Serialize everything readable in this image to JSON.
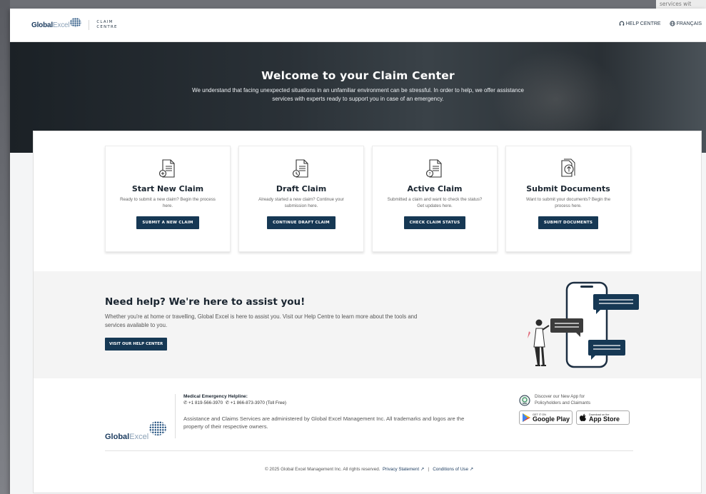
{
  "background_peek": "services wit",
  "header": {
    "logo_global": "Global",
    "logo_excel": "Excel",
    "claim": "CLAIM",
    "centre": "CENTRE",
    "help_centre": "HELP CENTRE",
    "language": "FRANÇAIS"
  },
  "hero": {
    "title": "Welcome to your Claim Center",
    "text": "We understand that facing unexpected situations in an unfamiliar environment can be stressful. In order to help, we offer assistance services with experts ready to support you in case of an emergency."
  },
  "cards": [
    {
      "icon": "new-claim-icon",
      "title": "Start New Claim",
      "text": "Ready to submit a new claim? Begin the process here.",
      "button": "SUBMIT A NEW CLAIM"
    },
    {
      "icon": "draft-claim-icon",
      "title": "Draft Claim",
      "text": "Already started a new claim? Continue your submission here.",
      "button": "CONTINUE DRAFT CLAIM"
    },
    {
      "icon": "active-claim-icon",
      "title": "Active Claim",
      "text": "Submitted a claim and want to check the status? Get updates here.",
      "button": "CHECK CLAIM STATUS"
    },
    {
      "icon": "upload-document-icon",
      "title": "Submit Documents",
      "text": "Want to submit your documents? Begin the process here.",
      "button": "SUBMIT DOCUMENTS"
    }
  ],
  "help": {
    "title": "Need help? We're here to assist you!",
    "text": "Whether you're at home or travelling, Global Excel is here to assist you. Visit our Help Centre to learn more about the tools and services available to you.",
    "button": "VISIT OUR HELP CENTER"
  },
  "footer": {
    "logo_global": "Global",
    "logo_excel": "Excel",
    "helpline_title": "Medical Emergency Helpline:",
    "phone1": "+1 819-566-3970",
    "phone2": "+1 866-873-3970 (Toll Free)",
    "disclaimer": "Assistance and Claims Services are administered by Global Excel Management Inc. All trademarks and logos are the property of their respective owners.",
    "app_line1": "Discover our New App for",
    "app_line2": "Policyholders and Claimants",
    "google_small": "GET IT ON",
    "google_big": "Google Play",
    "apple_small": "Download on the",
    "apple_big": "App Store",
    "copyright": "© 2025 Global Excel Management Inc. All rights reserved.",
    "privacy": "Privacy Statement",
    "separator": "|",
    "conditions": "Conditions of Use"
  },
  "colors": {
    "primary": "#163854",
    "hero_bg": "#2a3137",
    "page_bg": "#f4f5f6"
  }
}
